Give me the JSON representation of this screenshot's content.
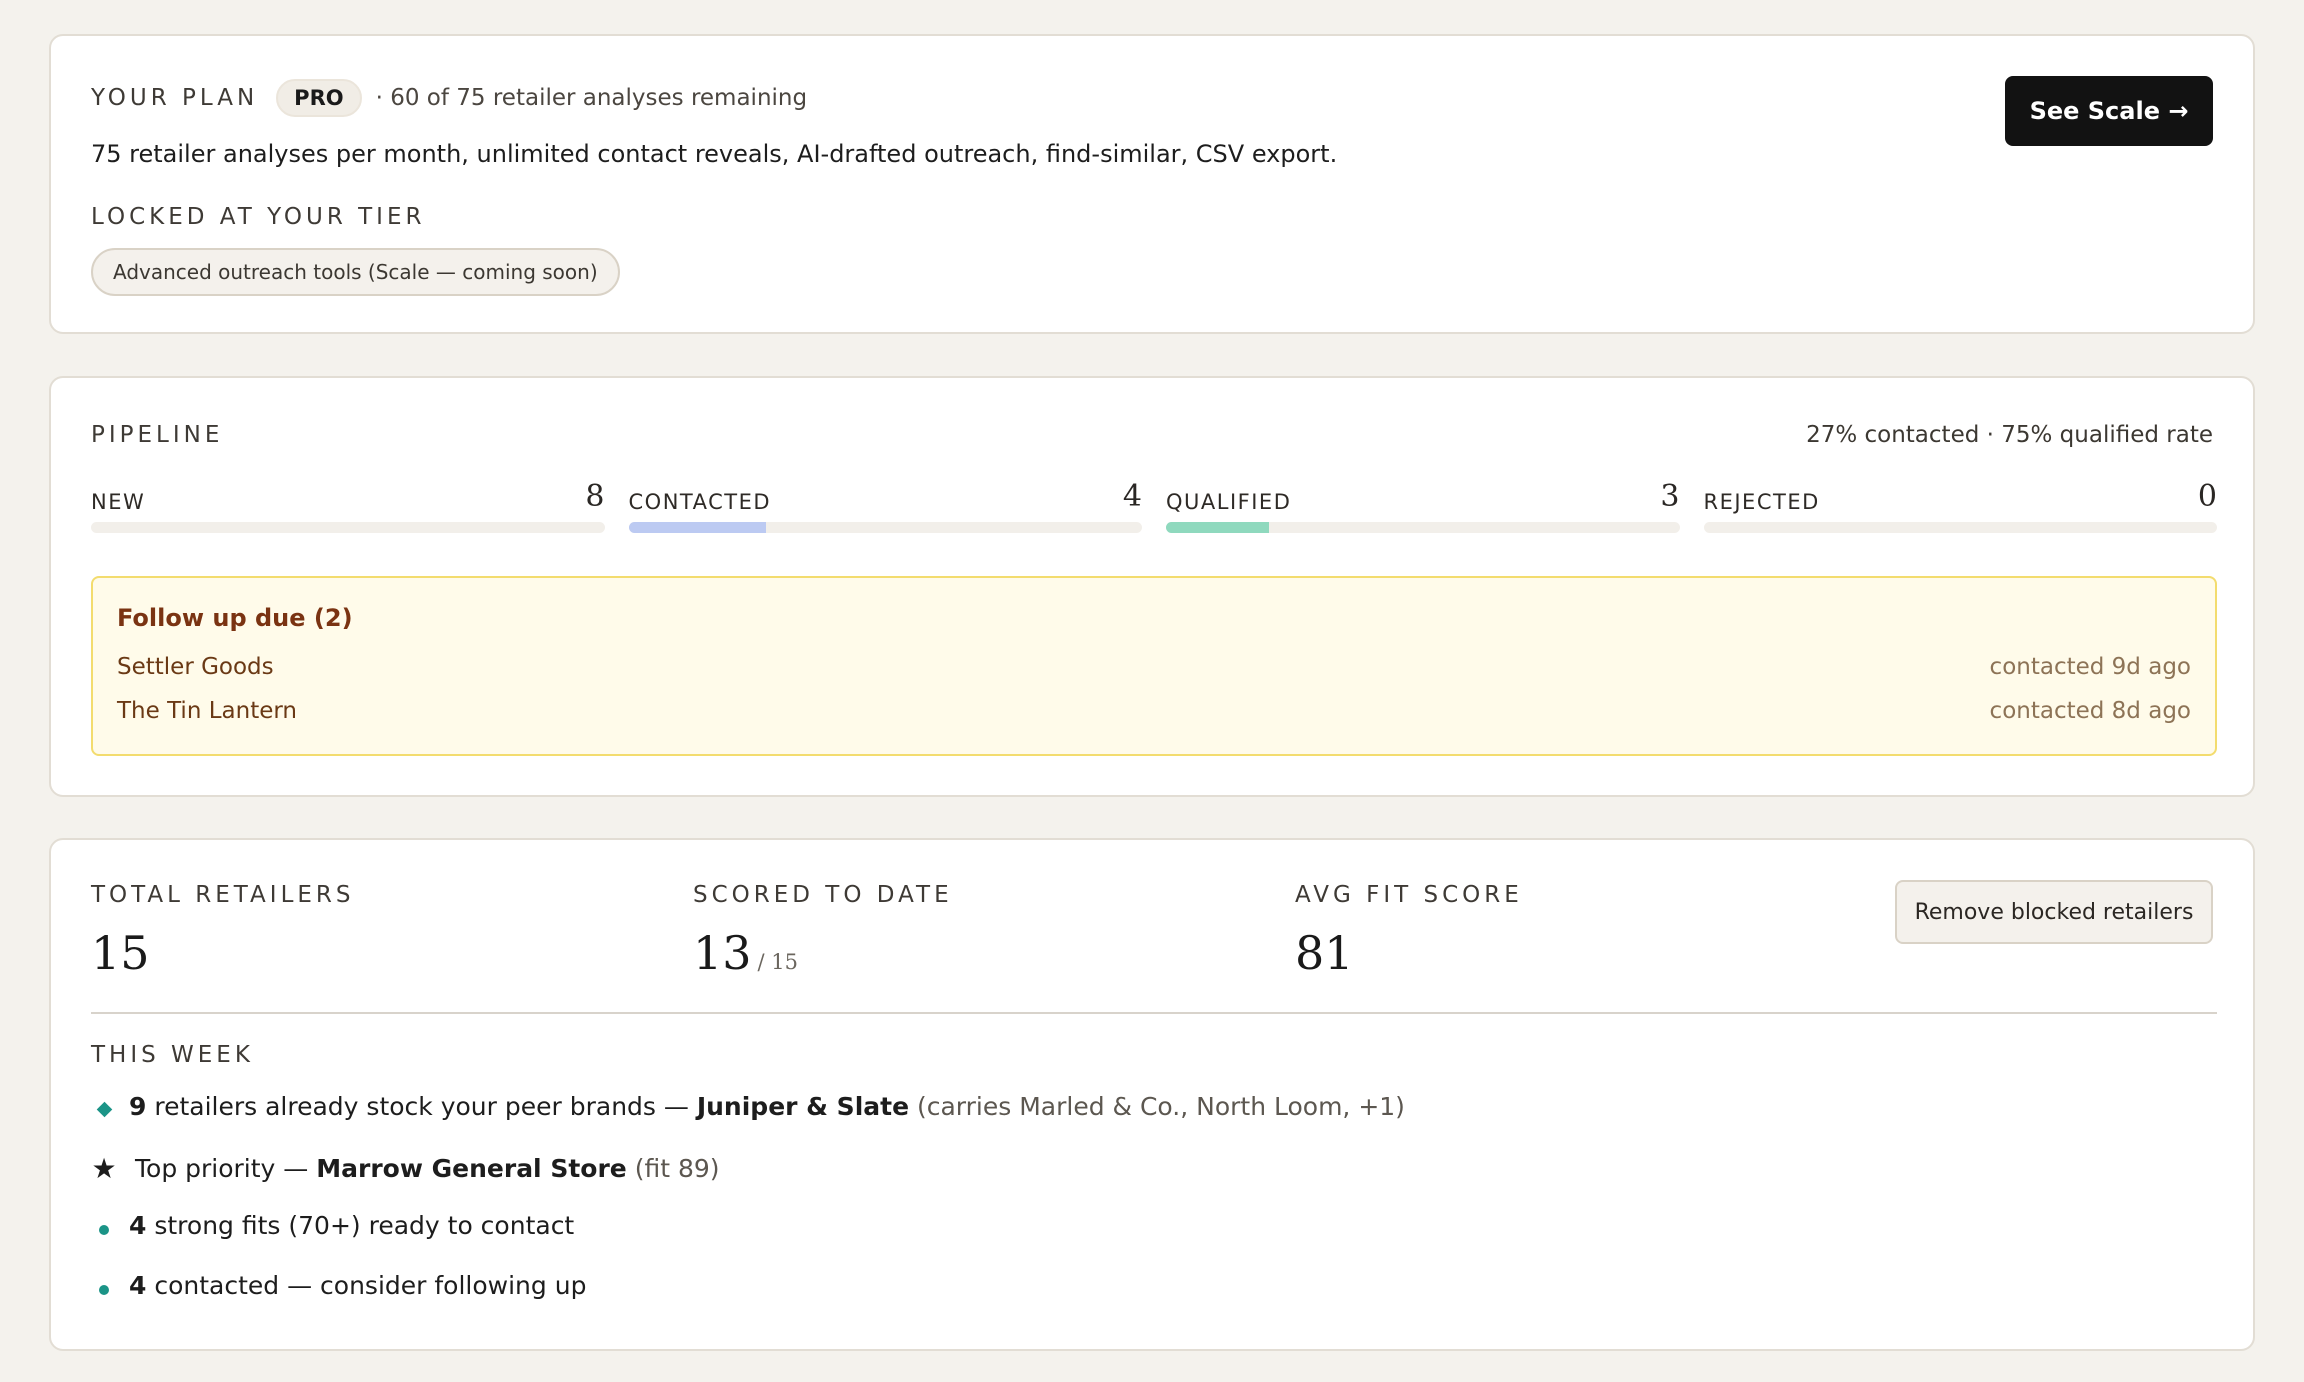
{
  "plan": {
    "title": "YOUR PLAN",
    "badge": "PRO",
    "remaining": "· 60 of 75 retailer analyses remaining",
    "description": "75 retailer analyses per month, unlimited contact reveals, AI-drafted outreach, find-similar, CSV export.",
    "locked_title": "LOCKED AT YOUR TIER",
    "locked_items": [
      "Advanced outreach tools (Scale — coming soon)"
    ],
    "cta_label": "See Scale →"
  },
  "pipeline": {
    "title": "PIPELINE",
    "rates": "27% contacted · 75% qualified rate",
    "total": 15,
    "stages": [
      {
        "label": "NEW",
        "count": "8",
        "fill": 0,
        "color": "#b9c9f2"
      },
      {
        "label": "CONTACTED",
        "count": "4",
        "fill": 0.267,
        "color": "#bccaf2"
      },
      {
        "label": "QUALIFIED",
        "count": "3",
        "fill": 0.2,
        "color": "#8fd9be"
      },
      {
        "label": "REJECTED",
        "count": "0",
        "fill": 0,
        "color": "#f2b5b5"
      }
    ],
    "followup": {
      "title": "Follow up due (2)",
      "items": [
        {
          "name": "Settler Goods",
          "ago": "contacted 9d ago"
        },
        {
          "name": "The Tin Lantern",
          "ago": "contacted 8d ago"
        }
      ]
    }
  },
  "stats": {
    "total_label": "TOTAL RETAILERS",
    "total_value": "15",
    "scored_label": "SCORED TO DATE",
    "scored_value": "13",
    "scored_sub": "/ 15",
    "avg_label": "AVG FIT SCORE",
    "avg_value": "81",
    "remove_button": "Remove blocked retailers"
  },
  "week": {
    "title": "THIS WEEK",
    "item1": {
      "count": "9",
      "text": " retailers already stock your peer brands — ",
      "brand": "Juniper & Slate",
      "note": " (carries Marled & Co., North Loom, +1)"
    },
    "item2": {
      "text": "Top priority — ",
      "store": "Marrow General Store",
      "note": " (fit 89)"
    },
    "item3": {
      "count": "4",
      "text": " strong fits (70+) ready to contact"
    },
    "item4": {
      "count": "4",
      "text": " contacted — consider following up"
    }
  },
  "icons": {
    "bullet_diamond": "diamond-icon",
    "bullet_star": "star-icon",
    "bullet_dot": "dot-icon",
    "accent_color": "#1b9487"
  }
}
